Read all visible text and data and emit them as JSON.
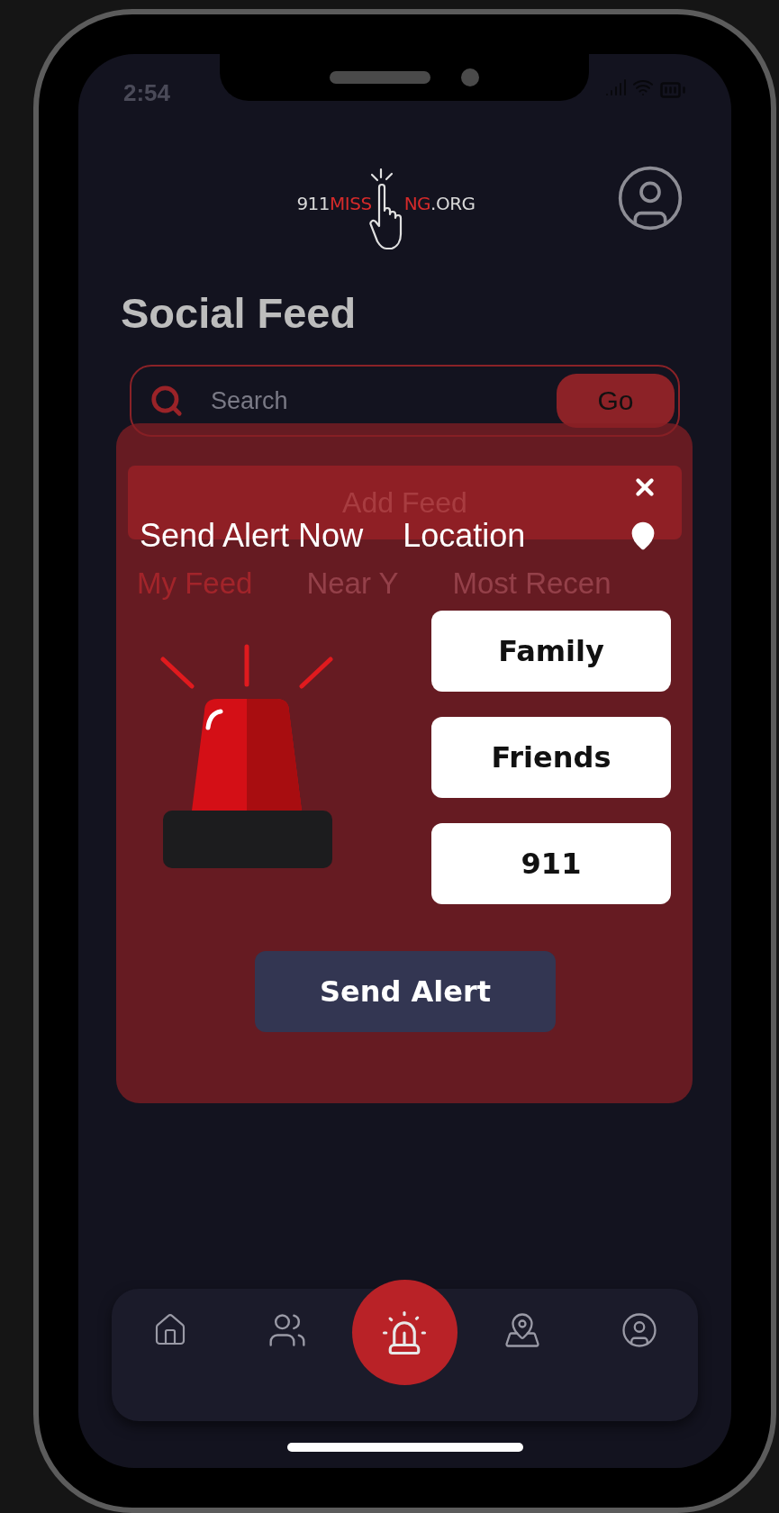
{
  "status_bar": {
    "time": "2:54"
  },
  "logo": {
    "prefix": "911",
    "highlight_start": "MISS",
    "highlight_end": "NG",
    "suffix": ".ORG"
  },
  "title": "Social Feed",
  "search": {
    "placeholder": "Search",
    "button": "Go"
  },
  "add_feed": "Add Feed",
  "feed_tabs": [
    {
      "label": "My Feed",
      "selected": true
    },
    {
      "label": "Near Y",
      "selected": false
    },
    {
      "label": "Most Recen",
      "selected": false
    }
  ],
  "alert_modal": {
    "title": "Send Alert Now",
    "location": "Location",
    "recipients": [
      {
        "label": "Family"
      },
      {
        "label": "Friends"
      },
      {
        "label": "911"
      }
    ],
    "action": "Send Alert"
  },
  "bottom_nav": [
    {
      "kind": "home",
      "selected": false
    },
    {
      "kind": "group",
      "selected": false
    },
    {
      "kind": "siren",
      "selected": true
    },
    {
      "kind": "map",
      "selected": false
    },
    {
      "kind": "profile",
      "selected": false
    }
  ]
}
